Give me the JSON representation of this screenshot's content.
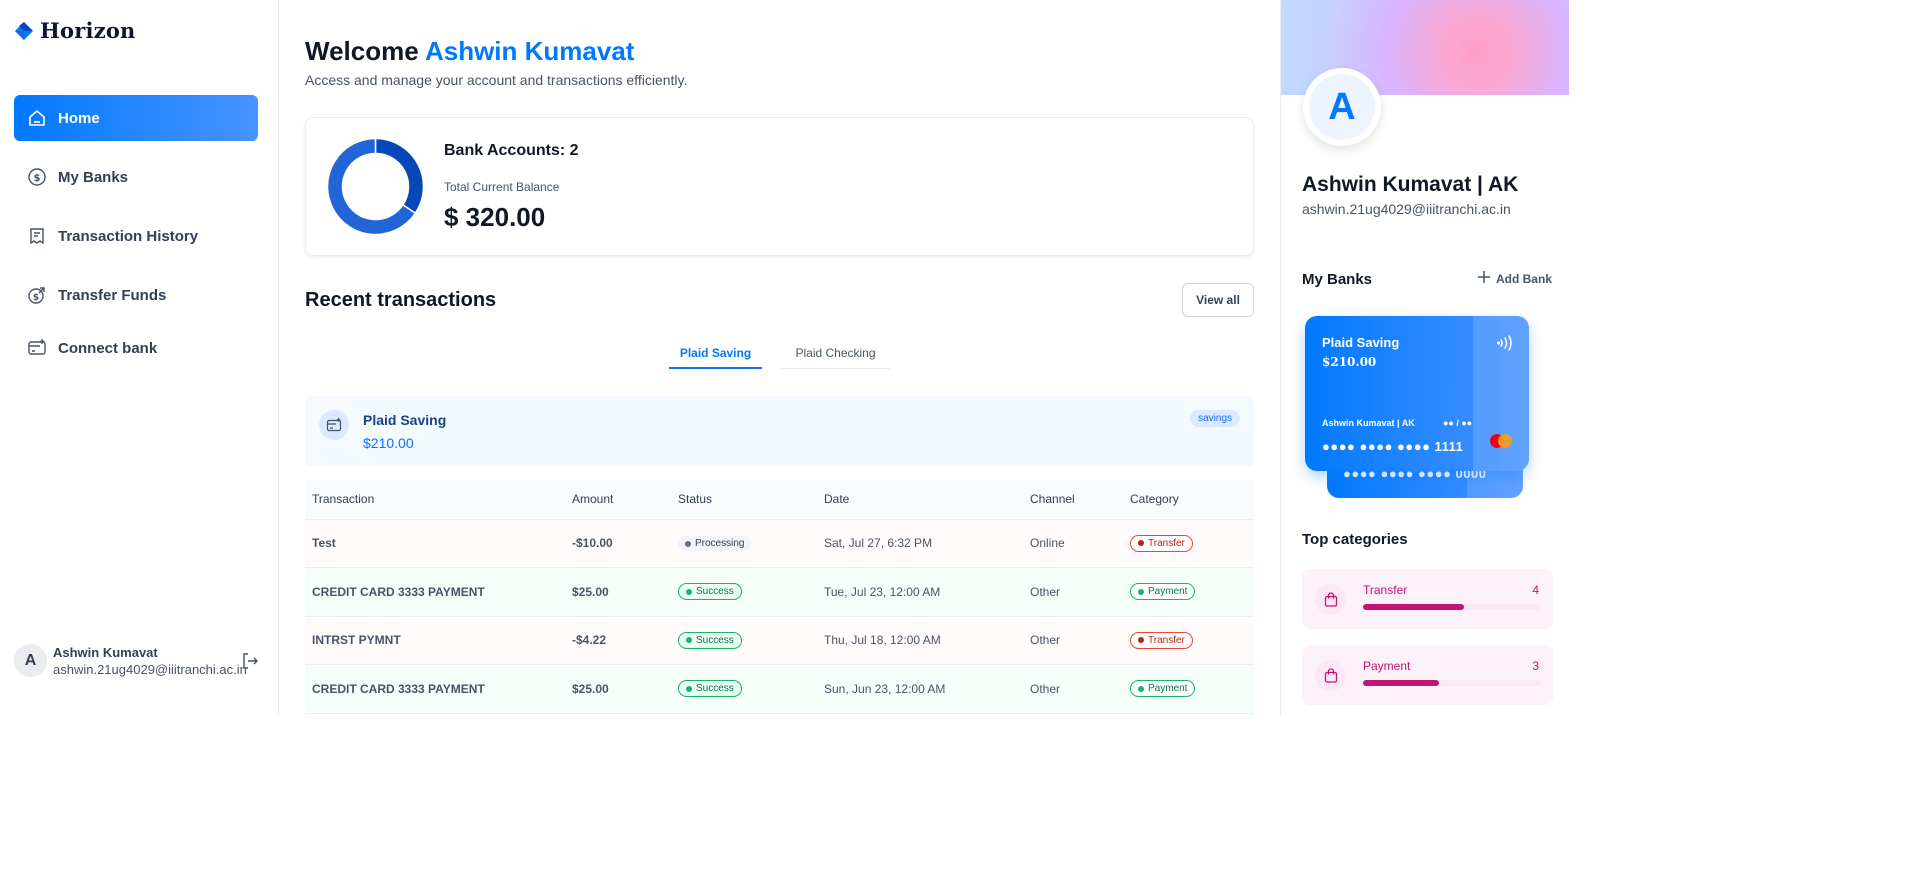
{
  "app": {
    "name": "Horizon"
  },
  "sidebar": {
    "items": [
      {
        "label": "Home",
        "icon": "home-icon",
        "active": true
      },
      {
        "label": "My Banks",
        "icon": "dollar-circle-icon",
        "active": false
      },
      {
        "label": "Transaction History",
        "icon": "receipt-icon",
        "active": false
      },
      {
        "label": "Transfer Funds",
        "icon": "money-send-icon",
        "active": false
      },
      {
        "label": "Connect bank",
        "icon": "card-add-icon",
        "active": false
      }
    ],
    "user": {
      "initial": "A",
      "name": "Ashwin Kumavat",
      "email": "ashwin.21ug4029@iiitranchi.ac.in"
    }
  },
  "header": {
    "welcome": "Welcome",
    "name": "Ashwin Kumavat",
    "subtitle": "Access and manage your account and transactions efficiently."
  },
  "balance": {
    "accounts_label": "Bank Accounts: 2",
    "total_label": "Total Current Balance",
    "total_value": "$ 320.00",
    "donut_shares": [
      0.344,
      0.656
    ],
    "donut_colors": [
      "#0747b6",
      "#2265d8"
    ]
  },
  "transactions": {
    "title": "Recent transactions",
    "view_all": "View all",
    "tabs": [
      {
        "label": "Plaid Saving",
        "active": true
      },
      {
        "label": "Plaid Checking",
        "active": false
      }
    ],
    "account": {
      "name": "Plaid Saving",
      "balance": "$210.00",
      "type": "savings"
    },
    "columns": [
      "Transaction",
      "Amount",
      "Status",
      "Date",
      "Channel",
      "Category"
    ],
    "rows": [
      {
        "name": "Test",
        "amount": "-$10.00",
        "status": "Processing",
        "date": "Sat, Jul 27, 6:32 PM",
        "channel": "Online",
        "category": "Transfer",
        "kind": "debit"
      },
      {
        "name": "CREDIT CARD 3333 PAYMENT",
        "amount": "$25.00",
        "status": "Success",
        "date": "Tue, Jul 23, 12:00 AM",
        "channel": "Other",
        "category": "Payment",
        "kind": "credit"
      },
      {
        "name": "INTRST PYMNT",
        "amount": "-$4.22",
        "status": "Success",
        "date": "Thu, Jul 18, 12:00 AM",
        "channel": "Other",
        "category": "Transfer",
        "kind": "debit"
      },
      {
        "name": "CREDIT CARD 3333 PAYMENT",
        "amount": "$25.00",
        "status": "Success",
        "date": "Sun, Jun 23, 12:00 AM",
        "channel": "Other",
        "category": "Payment",
        "kind": "credit"
      }
    ]
  },
  "profile": {
    "initial": "A",
    "name": "Ashwin Kumavat | AK",
    "email": "ashwin.21ug4029@iiitranchi.ac.in",
    "my_banks": "My Banks",
    "add_bank": "Add Bank",
    "card_front": {
      "name": "Plaid Saving",
      "balance": "$210.00",
      "holder": "Ashwin Kumavat | AK",
      "expiry": "●● / ●●",
      "number": "●●●● ●●●● ●●●● 1111"
    },
    "card_back": {
      "number": "●●●● ●●●● ●●●● 0000"
    },
    "top_categories": "Top categories",
    "categories": [
      {
        "name": "Transfer",
        "count": "4",
        "fraction": 0.57
      },
      {
        "name": "Payment",
        "count": "3",
        "fraction": 0.43
      }
    ]
  },
  "colors": {
    "accent": "#0179fe",
    "category": "#c11574"
  }
}
